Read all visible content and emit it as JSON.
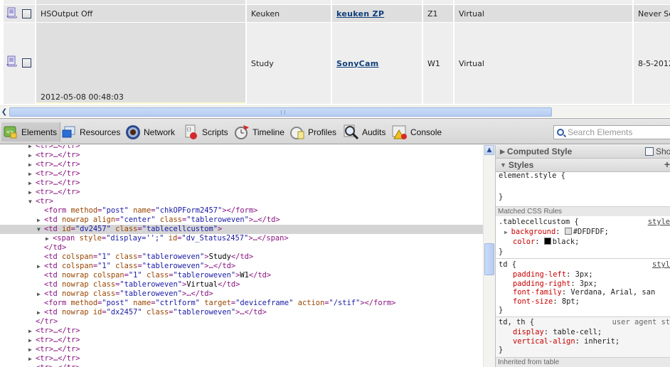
{
  "page_table": {
    "rows": [
      {
        "name": "HSOutput Off",
        "room": "Keuken",
        "device_link": "keuken ZP",
        "code": "Z1",
        "type": "Virtual",
        "last_change": "Never Se",
        "timestamp": ""
      },
      {
        "name": "",
        "room": "Study",
        "device_link": "SonyCam",
        "code": "W1",
        "type": "Virtual",
        "last_change": "8-5-2012",
        "timestamp": "2012-05-08 00:48:03"
      }
    ]
  },
  "devtools": {
    "toolbar": {
      "tabs": [
        {
          "label": "Elements",
          "icon": "elements-icon",
          "selected": true
        },
        {
          "label": "Resources",
          "icon": "resources-icon"
        },
        {
          "label": "Network",
          "icon": "network-icon"
        },
        {
          "label": "Scripts",
          "icon": "scripts-icon"
        },
        {
          "label": "Timeline",
          "icon": "timeline-icon"
        },
        {
          "label": "Profiles",
          "icon": "profiles-icon"
        },
        {
          "label": "Audits",
          "icon": "audits-icon"
        },
        {
          "label": "Console",
          "icon": "console-icon"
        }
      ],
      "search_placeholder": "Search Elements"
    },
    "dom_tree": {
      "collapsed_tr": "<tr>…</tr>",
      "open_tr": "<tr>",
      "close_tr": "</tr>",
      "form1": {
        "tag": "form",
        "attrs": [
          [
            "method",
            "post"
          ],
          [
            "name",
            "chkOPForm2457"
          ]
        ]
      },
      "td1": {
        "tag": "td",
        "attrs": [
          [
            "nowrap",
            null
          ],
          [
            "align",
            "center"
          ],
          [
            "class",
            "tableroweven"
          ]
        ]
      },
      "td_selected": {
        "tag": "td",
        "attrs": [
          [
            "id",
            "dv2457"
          ],
          [
            "class",
            "tablecellcustom"
          ]
        ]
      },
      "span1": {
        "tag": "span",
        "attrs": [
          [
            "style",
            "display='';"
          ],
          [
            "id",
            "dv_Status2457"
          ]
        ]
      },
      "close_td": "</td>",
      "td_study": {
        "tag": "td",
        "attrs": [
          [
            "colspan",
            "1"
          ],
          [
            "class",
            "tableroweven"
          ]
        ],
        "text": "Study"
      },
      "td_collapsed": {
        "tag": "td",
        "attrs": [
          [
            "colspan",
            "1"
          ],
          [
            "class",
            "tableroweven"
          ]
        ]
      },
      "td_w1": {
        "tag": "td",
        "attrs": [
          [
            "nowrap",
            null
          ],
          [
            "colspan",
            "1"
          ],
          [
            "class",
            "tableroweven"
          ]
        ],
        "text": "W1"
      },
      "td_virtual": {
        "tag": "td",
        "attrs": [
          [
            "nowrap",
            null
          ],
          [
            "class",
            "tableroweven"
          ]
        ],
        "text": "Virtual"
      },
      "td_nowrap": {
        "tag": "td",
        "attrs": [
          [
            "nowrap",
            null
          ],
          [
            "class",
            "tableroweven"
          ]
        ]
      },
      "form2": {
        "tag": "form",
        "attrs": [
          [
            "method",
            "post"
          ],
          [
            "name",
            "ctrlform"
          ],
          [
            "target",
            "deviceframe"
          ],
          [
            "action",
            "/stif"
          ]
        ]
      },
      "td_dx": {
        "tag": "td",
        "attrs": [
          [
            "nowrap",
            null
          ],
          [
            "id",
            "dx2457"
          ],
          [
            "class",
            "tableroweven"
          ]
        ]
      }
    },
    "sidebar": {
      "computed_style_label": "Computed Style",
      "show_inherited_label": "Sho",
      "styles_label": "Styles",
      "add_rule": "+",
      "element_style": "element.style {",
      "close_brace": "}",
      "matched_rules_label": "Matched CSS Rules",
      "rules": [
        {
          "selector": ".tablecellcustom {",
          "source": "style",
          "props": [
            {
              "name": "background",
              "value": "#DFDFDF;",
              "swatch": "#DFDFDF",
              "expandable": true
            },
            {
              "name": "color",
              "value": "black;",
              "swatch": "#000000"
            }
          ]
        },
        {
          "selector": "td {",
          "source": "styl",
          "props": [
            {
              "name": "padding-left",
              "value": "3px;"
            },
            {
              "name": "padding-right",
              "value": "3px;"
            },
            {
              "name": "font-family",
              "value": "Verdana, Arial, san"
            },
            {
              "name": "font-size",
              "value": "8pt;"
            }
          ]
        },
        {
          "selector": "td, th {",
          "source": "user agent st",
          "props": [
            {
              "name": "display",
              "value": "table-cell;"
            },
            {
              "name": "vertical-align",
              "value": "inherit;"
            }
          ]
        }
      ],
      "inherited_label": "Inherited from table"
    }
  },
  "colors": {
    "selected_cell_bg": "#DFDFDF",
    "row_bg": "#EEEEEE",
    "link": "#0E3F7A",
    "tag": "#881280",
    "attr": "#994500",
    "value": "#1A1AA6",
    "css_prop": "#C80000"
  }
}
